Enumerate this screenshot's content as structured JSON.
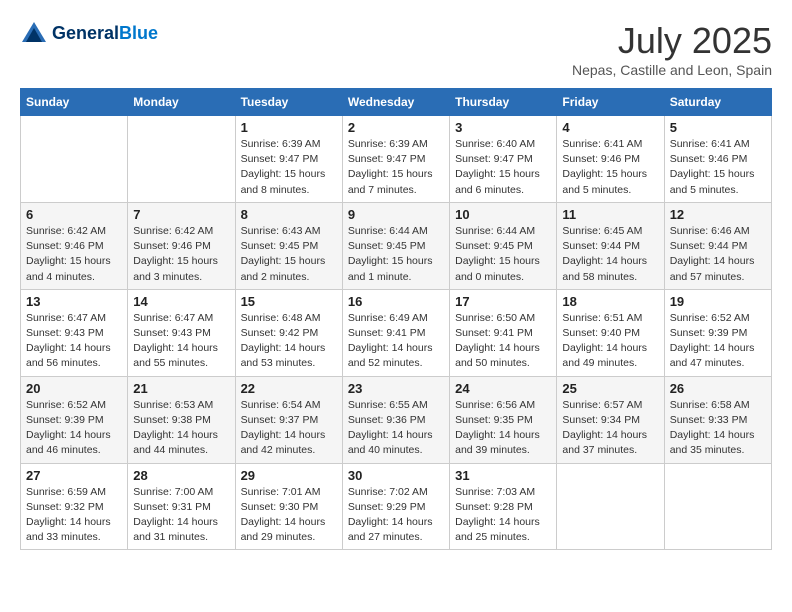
{
  "header": {
    "logo_line1": "General",
    "logo_line2": "Blue",
    "month": "July 2025",
    "location": "Nepas, Castille and Leon, Spain"
  },
  "weekdays": [
    "Sunday",
    "Monday",
    "Tuesday",
    "Wednesday",
    "Thursday",
    "Friday",
    "Saturday"
  ],
  "weeks": [
    [
      {
        "day": "",
        "info": ""
      },
      {
        "day": "",
        "info": ""
      },
      {
        "day": "1",
        "info": "Sunrise: 6:39 AM\nSunset: 9:47 PM\nDaylight: 15 hours\nand 8 minutes."
      },
      {
        "day": "2",
        "info": "Sunrise: 6:39 AM\nSunset: 9:47 PM\nDaylight: 15 hours\nand 7 minutes."
      },
      {
        "day": "3",
        "info": "Sunrise: 6:40 AM\nSunset: 9:47 PM\nDaylight: 15 hours\nand 6 minutes."
      },
      {
        "day": "4",
        "info": "Sunrise: 6:41 AM\nSunset: 9:46 PM\nDaylight: 15 hours\nand 5 minutes."
      },
      {
        "day": "5",
        "info": "Sunrise: 6:41 AM\nSunset: 9:46 PM\nDaylight: 15 hours\nand 5 minutes."
      }
    ],
    [
      {
        "day": "6",
        "info": "Sunrise: 6:42 AM\nSunset: 9:46 PM\nDaylight: 15 hours\nand 4 minutes."
      },
      {
        "day": "7",
        "info": "Sunrise: 6:42 AM\nSunset: 9:46 PM\nDaylight: 15 hours\nand 3 minutes."
      },
      {
        "day": "8",
        "info": "Sunrise: 6:43 AM\nSunset: 9:45 PM\nDaylight: 15 hours\nand 2 minutes."
      },
      {
        "day": "9",
        "info": "Sunrise: 6:44 AM\nSunset: 9:45 PM\nDaylight: 15 hours\nand 1 minute."
      },
      {
        "day": "10",
        "info": "Sunrise: 6:44 AM\nSunset: 9:45 PM\nDaylight: 15 hours\nand 0 minutes."
      },
      {
        "day": "11",
        "info": "Sunrise: 6:45 AM\nSunset: 9:44 PM\nDaylight: 14 hours\nand 58 minutes."
      },
      {
        "day": "12",
        "info": "Sunrise: 6:46 AM\nSunset: 9:44 PM\nDaylight: 14 hours\nand 57 minutes."
      }
    ],
    [
      {
        "day": "13",
        "info": "Sunrise: 6:47 AM\nSunset: 9:43 PM\nDaylight: 14 hours\nand 56 minutes."
      },
      {
        "day": "14",
        "info": "Sunrise: 6:47 AM\nSunset: 9:43 PM\nDaylight: 14 hours\nand 55 minutes."
      },
      {
        "day": "15",
        "info": "Sunrise: 6:48 AM\nSunset: 9:42 PM\nDaylight: 14 hours\nand 53 minutes."
      },
      {
        "day": "16",
        "info": "Sunrise: 6:49 AM\nSunset: 9:41 PM\nDaylight: 14 hours\nand 52 minutes."
      },
      {
        "day": "17",
        "info": "Sunrise: 6:50 AM\nSunset: 9:41 PM\nDaylight: 14 hours\nand 50 minutes."
      },
      {
        "day": "18",
        "info": "Sunrise: 6:51 AM\nSunset: 9:40 PM\nDaylight: 14 hours\nand 49 minutes."
      },
      {
        "day": "19",
        "info": "Sunrise: 6:52 AM\nSunset: 9:39 PM\nDaylight: 14 hours\nand 47 minutes."
      }
    ],
    [
      {
        "day": "20",
        "info": "Sunrise: 6:52 AM\nSunset: 9:39 PM\nDaylight: 14 hours\nand 46 minutes."
      },
      {
        "day": "21",
        "info": "Sunrise: 6:53 AM\nSunset: 9:38 PM\nDaylight: 14 hours\nand 44 minutes."
      },
      {
        "day": "22",
        "info": "Sunrise: 6:54 AM\nSunset: 9:37 PM\nDaylight: 14 hours\nand 42 minutes."
      },
      {
        "day": "23",
        "info": "Sunrise: 6:55 AM\nSunset: 9:36 PM\nDaylight: 14 hours\nand 40 minutes."
      },
      {
        "day": "24",
        "info": "Sunrise: 6:56 AM\nSunset: 9:35 PM\nDaylight: 14 hours\nand 39 minutes."
      },
      {
        "day": "25",
        "info": "Sunrise: 6:57 AM\nSunset: 9:34 PM\nDaylight: 14 hours\nand 37 minutes."
      },
      {
        "day": "26",
        "info": "Sunrise: 6:58 AM\nSunset: 9:33 PM\nDaylight: 14 hours\nand 35 minutes."
      }
    ],
    [
      {
        "day": "27",
        "info": "Sunrise: 6:59 AM\nSunset: 9:32 PM\nDaylight: 14 hours\nand 33 minutes."
      },
      {
        "day": "28",
        "info": "Sunrise: 7:00 AM\nSunset: 9:31 PM\nDaylight: 14 hours\nand 31 minutes."
      },
      {
        "day": "29",
        "info": "Sunrise: 7:01 AM\nSunset: 9:30 PM\nDaylight: 14 hours\nand 29 minutes."
      },
      {
        "day": "30",
        "info": "Sunrise: 7:02 AM\nSunset: 9:29 PM\nDaylight: 14 hours\nand 27 minutes."
      },
      {
        "day": "31",
        "info": "Sunrise: 7:03 AM\nSunset: 9:28 PM\nDaylight: 14 hours\nand 25 minutes."
      },
      {
        "day": "",
        "info": ""
      },
      {
        "day": "",
        "info": ""
      }
    ]
  ]
}
